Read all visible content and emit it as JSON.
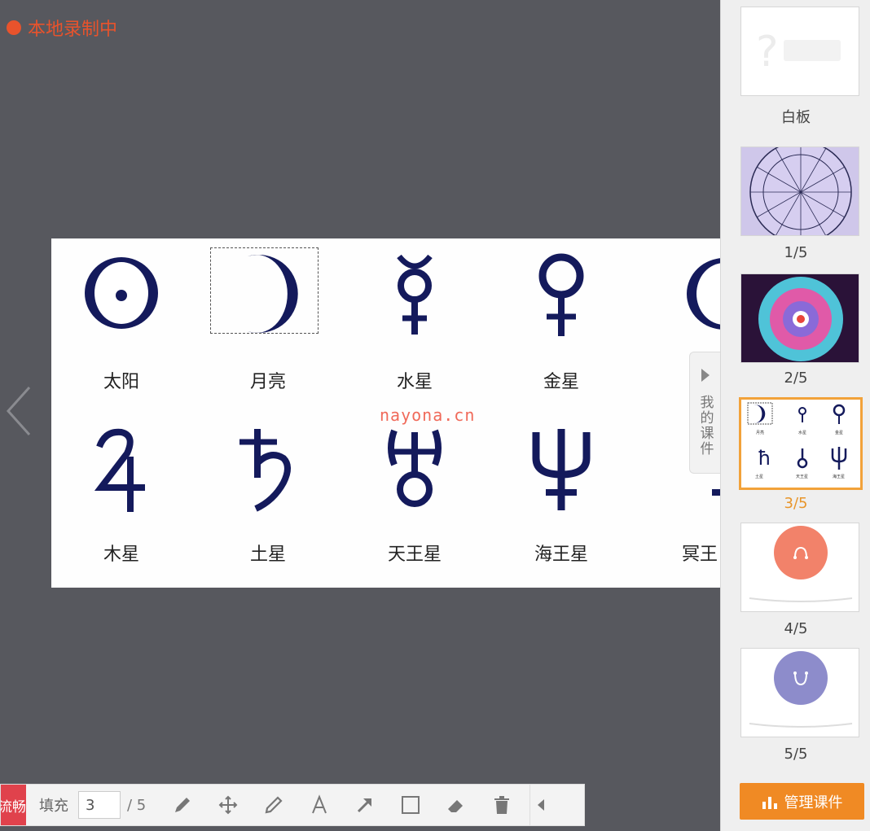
{
  "recording": {
    "label": "本地录制中",
    "color": "#e8532c"
  },
  "slide": {
    "symbols": [
      {
        "name": "太阳",
        "icon": "sun-symbol-icon"
      },
      {
        "name": "月亮",
        "icon": "moon-symbol-icon"
      },
      {
        "name": "水星",
        "icon": "mercury-symbol-icon"
      },
      {
        "name": "金星",
        "icon": "venus-symbol-icon"
      },
      {
        "name": "木星",
        "icon": "jupiter-symbol-icon"
      },
      {
        "name": "土星",
        "icon": "saturn-symbol-icon"
      },
      {
        "name": "天王星",
        "icon": "uranus-symbol-icon"
      },
      {
        "name": "海王星",
        "icon": "neptune-symbol-icon"
      },
      {
        "name": "冥王",
        "icon": "pluto-symbol-icon"
      }
    ],
    "symbol_color": "#141a5c"
  },
  "my_courseware_tab": {
    "label": "我的课件"
  },
  "watermark": "nayona.cn",
  "sidebar": {
    "thumbnails": [
      {
        "label": "白板",
        "active": false
      },
      {
        "label": "1/5",
        "active": false
      },
      {
        "label": "2/5",
        "active": false
      },
      {
        "label": "3/5",
        "active": true
      },
      {
        "label": "4/5",
        "active": false
      },
      {
        "label": "5/5",
        "active": false
      }
    ],
    "manage_button": "管理课件",
    "accent": "#f08a24"
  },
  "toolbar": {
    "status": "流畅",
    "fill_label": "填充",
    "page_value": "3",
    "page_total": "/ 5",
    "tools": [
      "pen-icon",
      "move-icon",
      "pencil-icon",
      "text-icon",
      "arrow-icon",
      "rectangle-icon",
      "eraser-icon",
      "trash-icon"
    ]
  }
}
